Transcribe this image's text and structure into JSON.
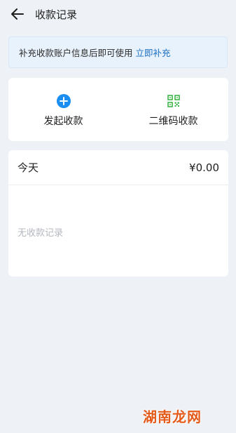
{
  "header": {
    "back_icon": "arrow-left-icon",
    "title": "收款记录"
  },
  "notice": {
    "text": "补充收款账户信息后即可使用",
    "link": "立即补充",
    "link_color": "#1a6fc2"
  },
  "actions": [
    {
      "label": "发起收款",
      "icon": "plus-circle-icon",
      "color": "#1a8ef2"
    },
    {
      "label": "二维码收款",
      "icon": "qr-code-icon",
      "color": "#3db54a"
    }
  ],
  "records": {
    "date_label": "今天",
    "amount": "¥0.00",
    "empty_text": "无收款记录"
  },
  "watermark": "湖南龙网"
}
